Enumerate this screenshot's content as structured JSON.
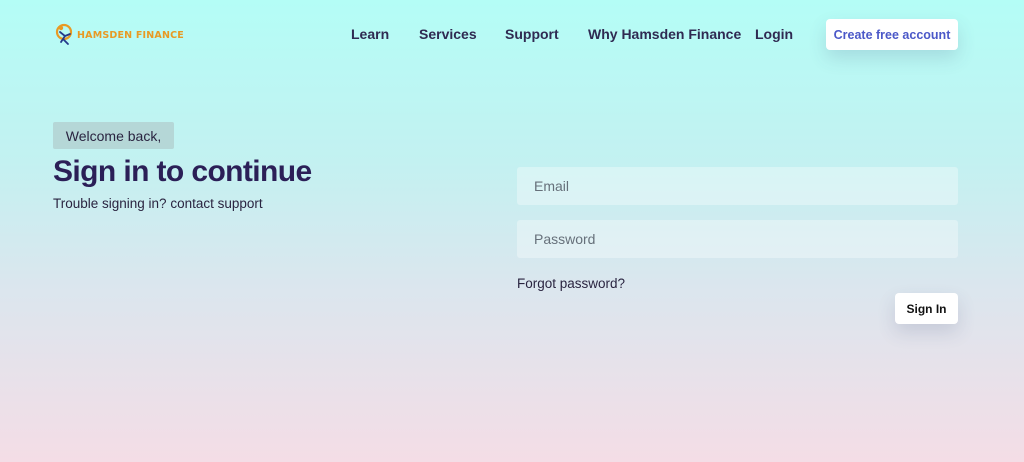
{
  "header": {
    "logo_text": "HAMSDEN FINANCE",
    "nav": [
      "Learn",
      "Services",
      "Support",
      "Why Hamsden Finance",
      "Login"
    ],
    "cta_label": "Create free account"
  },
  "hero": {
    "welcome": "Welcome back,",
    "title": "Sign in to continue",
    "subtitle": "Trouble signing in? contact support"
  },
  "form": {
    "email_placeholder": "Email",
    "password_placeholder": "Password",
    "forgot_label": "Forgot password?",
    "submit_label": "Sign In"
  },
  "colors": {
    "brand_orange": "#e89a24",
    "title_navy": "#2b1f57",
    "cta_text": "#4b58c8",
    "badge_bg": "#b5d7d7"
  }
}
